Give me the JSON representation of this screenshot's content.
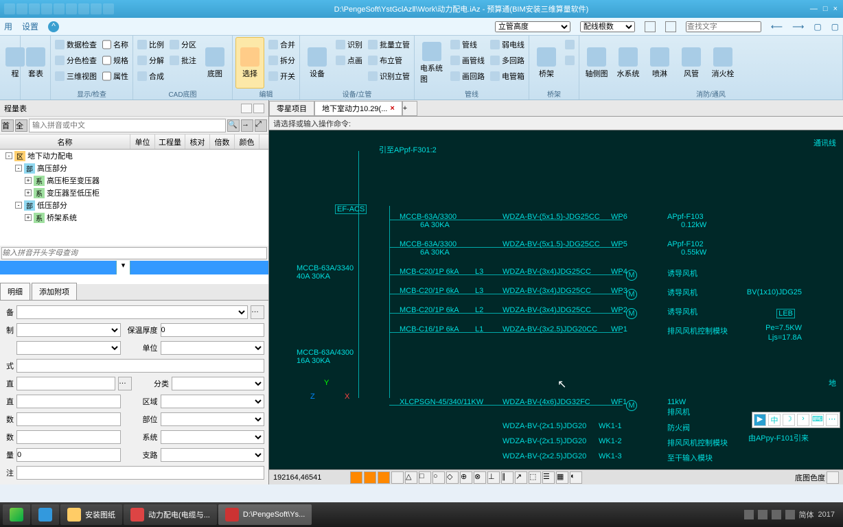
{
  "title": "D:\\PengeSoft\\YstGclAzⅡ\\Work\\动力配电.iAz - 预算通(BIM安装三维算量软件)",
  "menu": {
    "m1": "用",
    "m2": "设置"
  },
  "findbox": {
    "d1": "立管高度",
    "d2": "配线根数",
    "d3": "查找文字"
  },
  "ribbon": {
    "g1": {
      "i1": "数据检查",
      "i2": "分色检查",
      "i3": "三维视图",
      "i4": "名称",
      "i5": "规格",
      "i6": "属性",
      "lbl": "显示/检查"
    },
    "g0": {
      "i1": "套表",
      "i2": "程",
      "lbl": ""
    },
    "g2": {
      "i1": "比例",
      "i2": "分解",
      "i3": "合成",
      "i4": "分区",
      "i5": "批注",
      "lbl": "CAD底图",
      "big": "底图"
    },
    "g3": {
      "i1": "选择",
      "i2": "合并",
      "i3": "拆分",
      "i4": "开关",
      "lbl": "编辑"
    },
    "g4": {
      "i1": "设备",
      "i2": "识别",
      "i3": "点画",
      "i4": "批量立管",
      "i5": "布立管",
      "i6": "识别立管",
      "lbl": "设备/立管"
    },
    "g5": {
      "i1": "电系统图",
      "i2": "管线",
      "i3": "画管线",
      "i4": "画回路",
      "i5": "弱电线",
      "i6": "多回路",
      "i7": "电管箱",
      "lbl": "管线"
    },
    "g6": {
      "i1": "桥架",
      "lbl": "桥架"
    },
    "g7": {
      "i1": "轴侧图",
      "i2": "水系统",
      "i3": "喷淋",
      "i4": "风管",
      "i5": "消火栓",
      "lbl": "消防/通风"
    }
  },
  "panel": {
    "title": "程量表",
    "search_ph": "输入拼音或中文",
    "hdr": {
      "c1": "名称",
      "c2": "单位",
      "c3": "工程量",
      "c4": "核对",
      "c5": "倍数",
      "c6": "颜色"
    },
    "tree": [
      {
        "lvl": 0,
        "pm": "-",
        "badge": "区",
        "cls": "b-q",
        "txt": "地下动力配电"
      },
      {
        "lvl": 1,
        "pm": "-",
        "badge": "部",
        "cls": "b-b",
        "txt": "高压部分"
      },
      {
        "lvl": 2,
        "pm": "+",
        "badge": "系",
        "cls": "b-x",
        "txt": "高压柜至变压器"
      },
      {
        "lvl": 2,
        "pm": "+",
        "badge": "系",
        "cls": "b-x",
        "txt": "变压器至低压柜"
      },
      {
        "lvl": 1,
        "pm": "-",
        "badge": "部",
        "cls": "b-b",
        "txt": "低压部分"
      },
      {
        "lvl": 2,
        "pm": "+",
        "badge": "系",
        "cls": "b-x",
        "txt": "桥架系统"
      }
    ],
    "filter_ph": "输入拼音开头字母查询",
    "tabs": {
      "t1": "明细",
      "t2": "添加附项"
    },
    "props": {
      "r1_lbl": "备",
      "r2_lbl": "制",
      "r2b_lbl": "保温厚度",
      "r2b_val": "0",
      "r3_lbl": "",
      "r3b_lbl": "单位",
      "r4_lbl": "式",
      "r5_lbl": "直",
      "r5b_lbl": "分类",
      "r6_lbl": "直",
      "r6b_lbl": "区域",
      "r7_lbl": "数",
      "r7b_lbl": "部位",
      "r8_lbl": "数",
      "r8b_lbl": "系统",
      "r9_lbl": "量",
      "r9_val": "0",
      "r9b_lbl": "支路",
      "r10_lbl": "注"
    }
  },
  "doctabs": {
    "t1": "零星项目",
    "t2": "地下室动力10.29(..."
  },
  "cmdline": "请选择或输入操作命令:",
  "cad": {
    "coord": "192164,46541",
    "label_top": "引至APpf-F301:2",
    "label_tr": "通讯线",
    "efas": "EF-ACS",
    "mccb1": "MCCB-63A/3340\n40A 30KA",
    "mccb2": "MCCB-63A/4300\n16A 30KA",
    "rows": [
      {
        "l": "MCCB-63A/3300",
        "l2": "6A   30KA",
        "mid": "",
        "cable": "WDZA-BV-(5x1.5)-JDG25CC",
        "wp": "WP6",
        "r": "APpf-F103",
        "r2": "0.12kW"
      },
      {
        "l": "MCCB-63A/3300",
        "l2": "6A   30KA",
        "mid": "",
        "cable": "WDZA-BV-(5x1.5)-JDG25CC",
        "wp": "WP5",
        "r": "APpf-F102",
        "r2": "0.55kW"
      },
      {
        "l": "MCB-C20/1P 6kA",
        "l2": "",
        "mid": "L3",
        "cable": "WDZA-BV-(3x4)JDG25CC",
        "wp": "WP4",
        "r": "诱导风机",
        "m": "M"
      },
      {
        "l": "MCB-C20/1P 6kA",
        "l2": "",
        "mid": "L3",
        "cable": "WDZA-BV-(3x4)JDG25CC",
        "wp": "WP3",
        "r": "诱导风机",
        "m": "M"
      },
      {
        "l": "MCB-C20/1P 6kA",
        "l2": "",
        "mid": "L2",
        "cable": "WDZA-BV-(3x4)JDG25CC",
        "wp": "WP2",
        "r": "诱导风机",
        "m": "M"
      },
      {
        "l": "MCB-C16/1P 6kA",
        "l2": "",
        "mid": "L1",
        "cable": "WDZA-BV-(3x2.5)JDG20CC",
        "wp": "WP1",
        "r": "排风风机控制模块"
      }
    ],
    "wf": {
      "l": "XLCPSGN-45/340/11KW",
      "cable": "WDZA-BV-(4x6)JDG32FC",
      "wp": "WF1",
      "r": "11kW",
      "r2": "排风机",
      "m": "M"
    },
    "wk": [
      {
        "cable": "WDZA-BV-(2x1.5)JDG20",
        "wp": "WK1-1",
        "r": "防火阀"
      },
      {
        "cable": "WDZA-BV-(2x1.5)JDG20",
        "wp": "WK1-2",
        "r": "排风风机控制模块"
      },
      {
        "cable": "WDZA-BV-(2x2.5)JDG20",
        "wp": "WK1-3",
        "r": "至干输入模块"
      }
    ],
    "rside": {
      "pe": "Pe=7.5KW",
      "ljs": "Ljs=17.8A",
      "bv": "BV(1x10)JDG25",
      "leb": "LEB",
      "by": "由APpy-F101引来",
      "di": "地"
    },
    "axis": {
      "y": "Y",
      "x": "X",
      "z": "Z"
    },
    "bottomlbl": "底图色度"
  },
  "taskbar": {
    "t1": "安装图纸",
    "t2": "动力配电(电缆与...",
    "t3": "D:\\PengeSoft\\Ys...",
    "lang": "简体",
    "year": "2017"
  }
}
